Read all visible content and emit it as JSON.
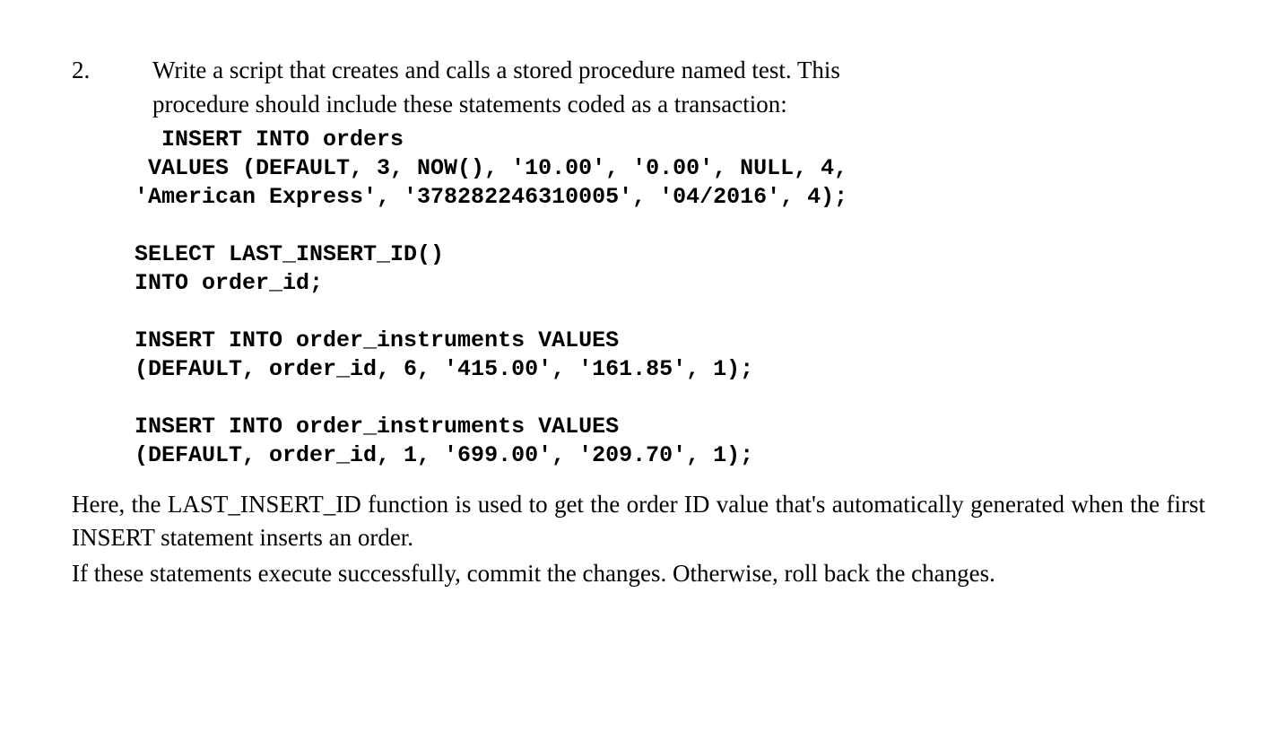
{
  "question": {
    "number": "2.",
    "prompt_line1": "Write a script that creates and calls a stored procedure named test. This",
    "prompt_line2": "procedure should include these statements coded as a transaction:"
  },
  "code": {
    "line1": "  INSERT INTO orders",
    "line2": " VALUES (DEFAULT, 3, NOW(), '10.00', '0.00', NULL, 4,",
    "line3": "'American Express', '378282246310005', '04/2016', 4);",
    "blank1": "",
    "line4": "SELECT LAST_INSERT_ID()",
    "line5": "INTO order_id;",
    "blank2": "",
    "line6": "INSERT INTO order_instruments VALUES",
    "line7": "(DEFAULT, order_id, 6, '415.00', '161.85', 1);",
    "blank3": "",
    "line8": "INSERT INTO order_instruments VALUES",
    "line9": "(DEFAULT, order_id, 1, '699.00', '209.70', 1);"
  },
  "footer": {
    "para1": "Here, the LAST_INSERT_ID function is used to get the order ID value that's automatically generated when the first INSERT statement inserts an order.",
    "para2": "If these statements execute successfully, commit the changes. Otherwise, roll back the changes."
  }
}
